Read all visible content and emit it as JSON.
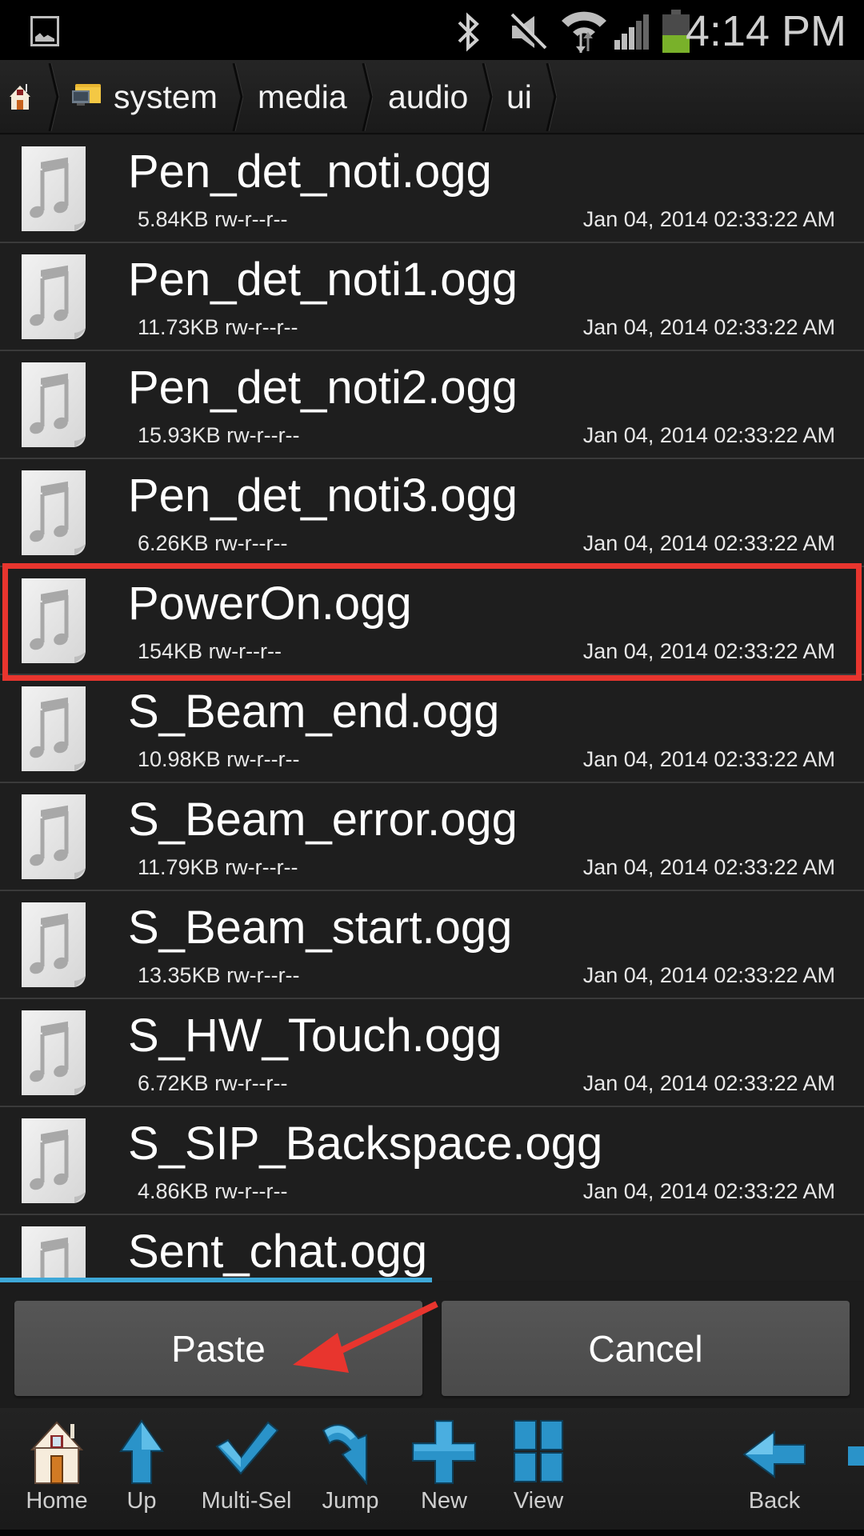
{
  "status_bar": {
    "time": "4:14 PM",
    "icons": [
      "gallery-notification-icon",
      "bluetooth-icon",
      "mute-icon",
      "wifi-icon",
      "signal-icon",
      "battery-icon"
    ],
    "battery_level": 0.45,
    "battery_color": "#79b12a"
  },
  "breadcrumb": {
    "home_icon": "home-icon",
    "items": [
      {
        "label": "system",
        "icon": "folder-icon"
      },
      {
        "label": "media"
      },
      {
        "label": "audio"
      },
      {
        "label": "ui"
      }
    ]
  },
  "files": [
    {
      "name": "Pen_det_noti.ogg",
      "size": "5.84KB",
      "perms": "rw-r--r--",
      "date": "Jan 04, 2014 02:33:22 AM"
    },
    {
      "name": "Pen_det_noti1.ogg",
      "size": "11.73KB",
      "perms": "rw-r--r--",
      "date": "Jan 04, 2014 02:33:22 AM"
    },
    {
      "name": "Pen_det_noti2.ogg",
      "size": "15.93KB",
      "perms": "rw-r--r--",
      "date": "Jan 04, 2014 02:33:22 AM"
    },
    {
      "name": "Pen_det_noti3.ogg",
      "size": "6.26KB",
      "perms": "rw-r--r--",
      "date": "Jan 04, 2014 02:33:22 AM"
    },
    {
      "name": "PowerOn.ogg",
      "size": "154KB",
      "perms": "rw-r--r--",
      "date": "Jan 04, 2014 02:33:22 AM",
      "highlighted": true
    },
    {
      "name": "S_Beam_end.ogg",
      "size": "10.98KB",
      "perms": "rw-r--r--",
      "date": "Jan 04, 2014 02:33:22 AM"
    },
    {
      "name": "S_Beam_error.ogg",
      "size": "11.79KB",
      "perms": "rw-r--r--",
      "date": "Jan 04, 2014 02:33:22 AM"
    },
    {
      "name": "S_Beam_start.ogg",
      "size": "13.35KB",
      "perms": "rw-r--r--",
      "date": "Jan 04, 2014 02:33:22 AM"
    },
    {
      "name": "S_HW_Touch.ogg",
      "size": "6.72KB",
      "perms": "rw-r--r--",
      "date": "Jan 04, 2014 02:33:22 AM"
    },
    {
      "name": "S_SIP_Backspace.ogg",
      "size": "4.86KB",
      "perms": "rw-r--r--",
      "date": "Jan 04, 2014 02:33:22 AM"
    },
    {
      "name": "Sent_chat.ogg",
      "size": "",
      "perms": "",
      "date": ""
    }
  ],
  "file_icon": "audio-file-icon",
  "highlight_color": "#e8352e",
  "scroll_accent": "#3ea8d8",
  "actions": {
    "paste": "Paste",
    "cancel": "Cancel"
  },
  "annotation": {
    "type": "arrow",
    "points_to": "Paste",
    "color": "#e8352e"
  },
  "toolbar": [
    {
      "label": "Home",
      "icon": "home-icon"
    },
    {
      "label": "Up",
      "icon": "up-arrow-icon"
    },
    {
      "label": "Multi-Sel",
      "icon": "checkmark-icon"
    },
    {
      "label": "Jump",
      "icon": "jump-arrow-icon"
    },
    {
      "label": "New",
      "icon": "plus-icon"
    },
    {
      "label": "View",
      "icon": "grid-view-icon"
    },
    {
      "label": "Back",
      "icon": "back-arrow-icon"
    }
  ]
}
